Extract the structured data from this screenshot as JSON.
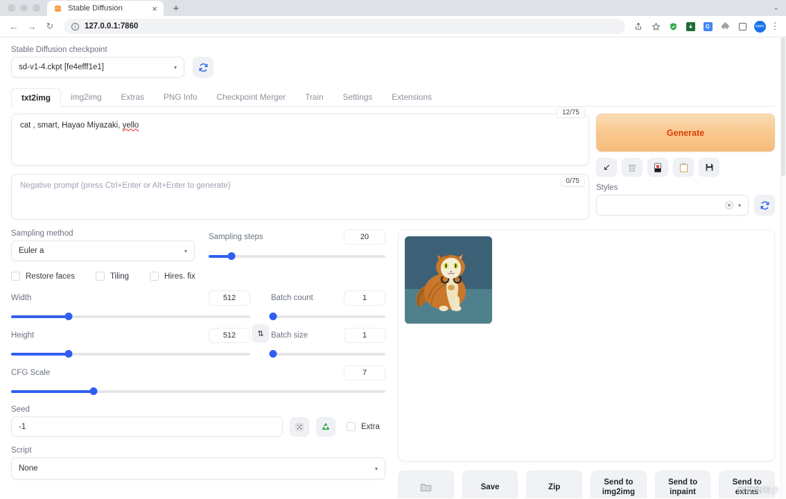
{
  "browser": {
    "tab": {
      "title": "Stable Diffusion",
      "favicon": "stable-diffusion-logo",
      "close": "×"
    },
    "new_tab": "+",
    "tab_list_chevron": "⌄",
    "nav": {
      "back": "←",
      "forward": "→",
      "reload": "↻"
    },
    "omnibox": {
      "url": "127.0.0.1:7860",
      "info": "i"
    },
    "toolbar_icons": [
      {
        "name": "share-icon",
        "glyph": "⤴"
      },
      {
        "name": "bookmark-star-icon",
        "glyph": "☆"
      },
      {
        "name": "adblock-shield-icon",
        "glyph": "✓"
      },
      {
        "name": "download-icon",
        "glyph": "⬇"
      },
      {
        "name": "translate-icon",
        "glyph": "G"
      },
      {
        "name": "extensions-puzzle-icon",
        "glyph": "✦"
      },
      {
        "name": "side-panel-icon",
        "glyph": ""
      },
      {
        "name": "profile-avatar",
        "glyph": "sppo"
      },
      {
        "name": "browser-menu-icon",
        "glyph": "⋮"
      }
    ]
  },
  "checkpoint": {
    "label": "Stable Diffusion checkpoint",
    "value": "sd-v1-4.ckpt [fe4efff1e1]",
    "refresh_icon": "⟳"
  },
  "tabs": [
    {
      "label": "txt2img",
      "active": true
    },
    {
      "label": "img2img",
      "active": false
    },
    {
      "label": "Extras",
      "active": false
    },
    {
      "label": "PNG Info",
      "active": false
    },
    {
      "label": "Checkpoint Merger",
      "active": false
    },
    {
      "label": "Train",
      "active": false
    },
    {
      "label": "Settings",
      "active": false
    },
    {
      "label": "Extensions",
      "active": false
    }
  ],
  "prompt": {
    "text_a": "cat ,  smart,  Hayao Miyazaki, ",
    "text_misspelled": "yello",
    "counter": "12/75"
  },
  "negative_prompt": {
    "placeholder": "Negative prompt (press Ctrl+Enter or Alt+Enter to generate)",
    "counter": "0/75"
  },
  "generate": {
    "label": "Generate",
    "accent_color": "#d9400c",
    "tools": [
      {
        "name": "restore-progress-icon",
        "glyph": "↙"
      },
      {
        "name": "clear-prompt-trash-icon",
        "glyph": "🗑"
      },
      {
        "name": "show-extra-networks-icon",
        "glyph": "🎴"
      },
      {
        "name": "apply-style-clipboard-icon",
        "glyph": "📋"
      },
      {
        "name": "save-style-floppy-icon",
        "glyph": "💾"
      }
    ]
  },
  "styles": {
    "label": "Styles",
    "value": "",
    "clear_glyph": "✕",
    "caret": "▾",
    "refresh_icon": "⟳"
  },
  "sampling": {
    "method_label": "Sampling method",
    "method_value": "Euler a",
    "steps_label": "Sampling steps",
    "steps_value": "20",
    "steps_percent": 13
  },
  "toggles": [
    {
      "label": "Restore faces",
      "checked": false
    },
    {
      "label": "Tiling",
      "checked": false
    },
    {
      "label": "Hires. fix",
      "checked": false
    }
  ],
  "dimensions": {
    "width_label": "Width",
    "width_value": "512",
    "width_percent": 24,
    "height_label": "Height",
    "height_value": "512",
    "height_percent": 24,
    "swap_icon": "⇅"
  },
  "batch": {
    "count_label": "Batch count",
    "count_value": "1",
    "count_percent": 2,
    "size_label": "Batch size",
    "size_value": "1",
    "size_percent": 2
  },
  "cfg": {
    "label": "CFG Scale",
    "value": "7",
    "percent": 22
  },
  "seed": {
    "label": "Seed",
    "value": "-1",
    "dice_icon": "🎲",
    "recycle_icon": "♻",
    "extra_label": "Extra",
    "extra_checked": false
  },
  "script": {
    "label": "Script",
    "value": "None"
  },
  "gallery": {
    "image_alt": "orange cat illustration",
    "image_colors": {
      "background_top": "#3c6076",
      "background_floor": "#4f7b88",
      "fur": "#c8772b",
      "fur_light": "#e0b36e",
      "belly": "#f1e6c4",
      "eye": "#d9e04a"
    }
  },
  "result_buttons": [
    {
      "label": "",
      "icon": "🗀",
      "name": "open-folder-button"
    },
    {
      "label": "Save",
      "icon": "",
      "name": "save-button"
    },
    {
      "label": "Zip",
      "icon": "",
      "name": "zip-button"
    },
    {
      "label": "Send to img2img",
      "icon": "",
      "name": "send-to-img2img-button"
    },
    {
      "label": "Send to inpaint",
      "icon": "",
      "name": "send-to-inpaint-button"
    },
    {
      "label": "Send to extras",
      "icon": "",
      "name": "send-to-extras-button"
    }
  ],
  "watermark": {
    "text_primary": "CSDN",
    "text_secondary": "@花生糖@"
  }
}
